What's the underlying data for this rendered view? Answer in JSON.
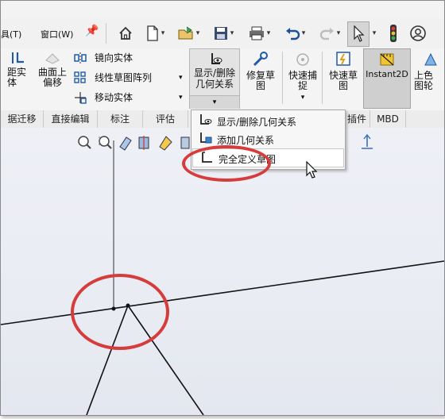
{
  "menubar": {
    "tools_label": "具(T)",
    "window_label": "窗口(W)"
  },
  "ribbon": {
    "offset_entities": [
      "距实",
      "体"
    ],
    "offset_surface": [
      "曲面上",
      "偏移"
    ],
    "mirror_entities": "镜向实体",
    "linear_pattern": "线性草图阵列",
    "move_entities": "移动实体",
    "display_delete_relations": [
      "显示/删除",
      "几何关系"
    ],
    "repair_sketch": [
      "修复草",
      "图"
    ],
    "quick_snaps": [
      "快速捕",
      "捉"
    ],
    "rapid_sketch": [
      "快速草",
      "图"
    ],
    "instant2d": "Instant2D",
    "shaded_sketch_contours": [
      "上色",
      "图轮"
    ]
  },
  "tabs": [
    "据迁移",
    "直接编辑",
    "标注",
    "评估",
    "插件",
    "MBD"
  ],
  "dropdown": {
    "items": [
      "显示/删除几何关系",
      "添加几何关系",
      "完全定义草图"
    ]
  },
  "colors": {
    "highlight_oval": "#d63c3c",
    "accent_yellow": "#f3c331"
  }
}
